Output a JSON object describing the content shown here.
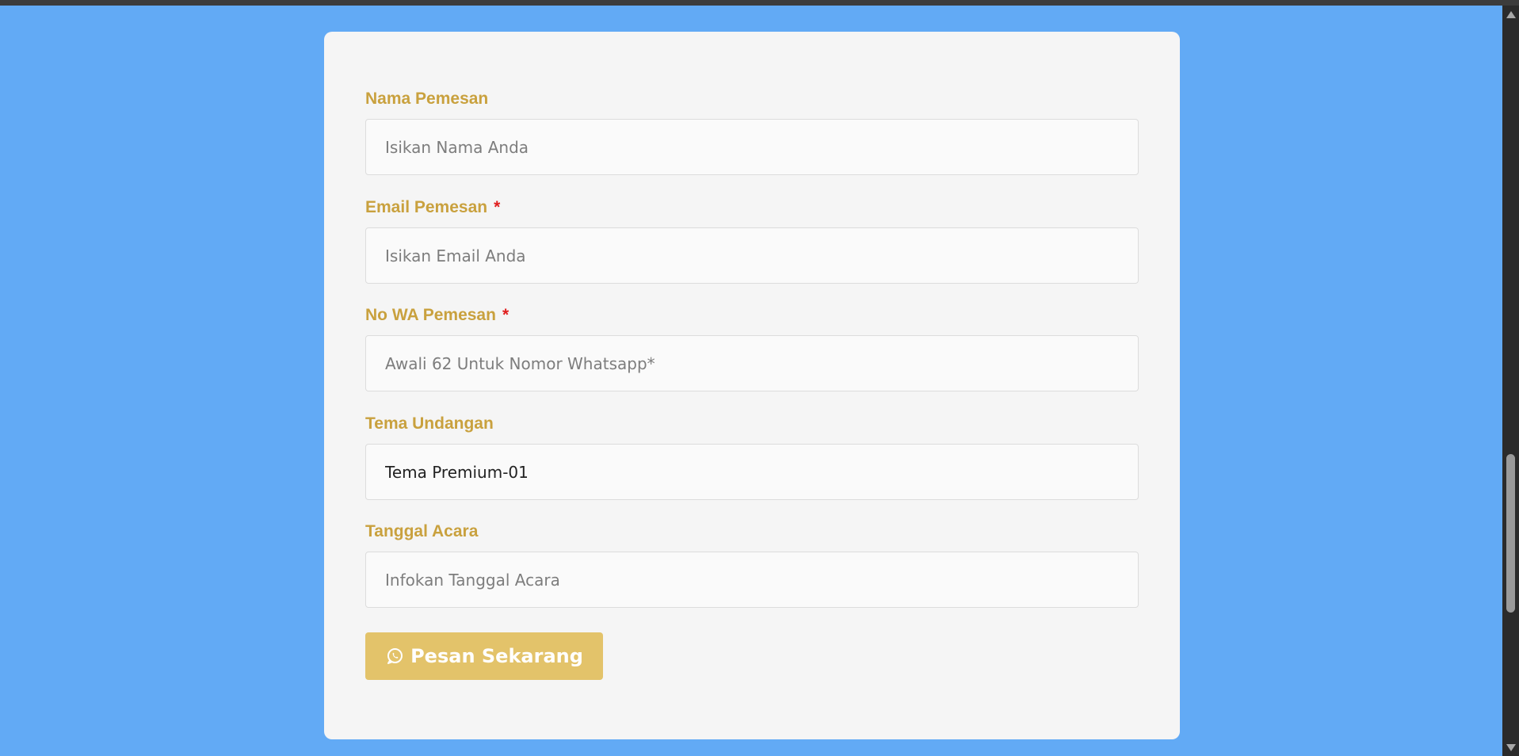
{
  "form": {
    "fields": [
      {
        "label": "Nama Pemesan",
        "placeholder": "Isikan Nama Anda",
        "value": "",
        "required": false
      },
      {
        "label": "Email Pemesan",
        "placeholder": "Isikan Email Anda",
        "value": "",
        "required": true
      },
      {
        "label": "No WA Pemesan",
        "placeholder": "Awali 62 Untuk Nomor Whatsapp*",
        "value": "",
        "required": true
      },
      {
        "label": "Tema Undangan",
        "placeholder": "",
        "value": "Tema Premium-01",
        "required": false
      },
      {
        "label": "Tanggal Acara",
        "placeholder": "Infokan Tanggal Acara",
        "value": "",
        "required": false
      }
    ],
    "required_marker": "*",
    "submit": {
      "label": "Pesan Sekarang",
      "icon": "whatsapp-icon"
    }
  },
  "colors": {
    "page_background": "#62aaf5",
    "card_background": "#f5f5f5",
    "label": "#c9a13e",
    "required_marker": "#e01e1e",
    "button": "#e3c36a",
    "button_text": "#ffffff"
  }
}
